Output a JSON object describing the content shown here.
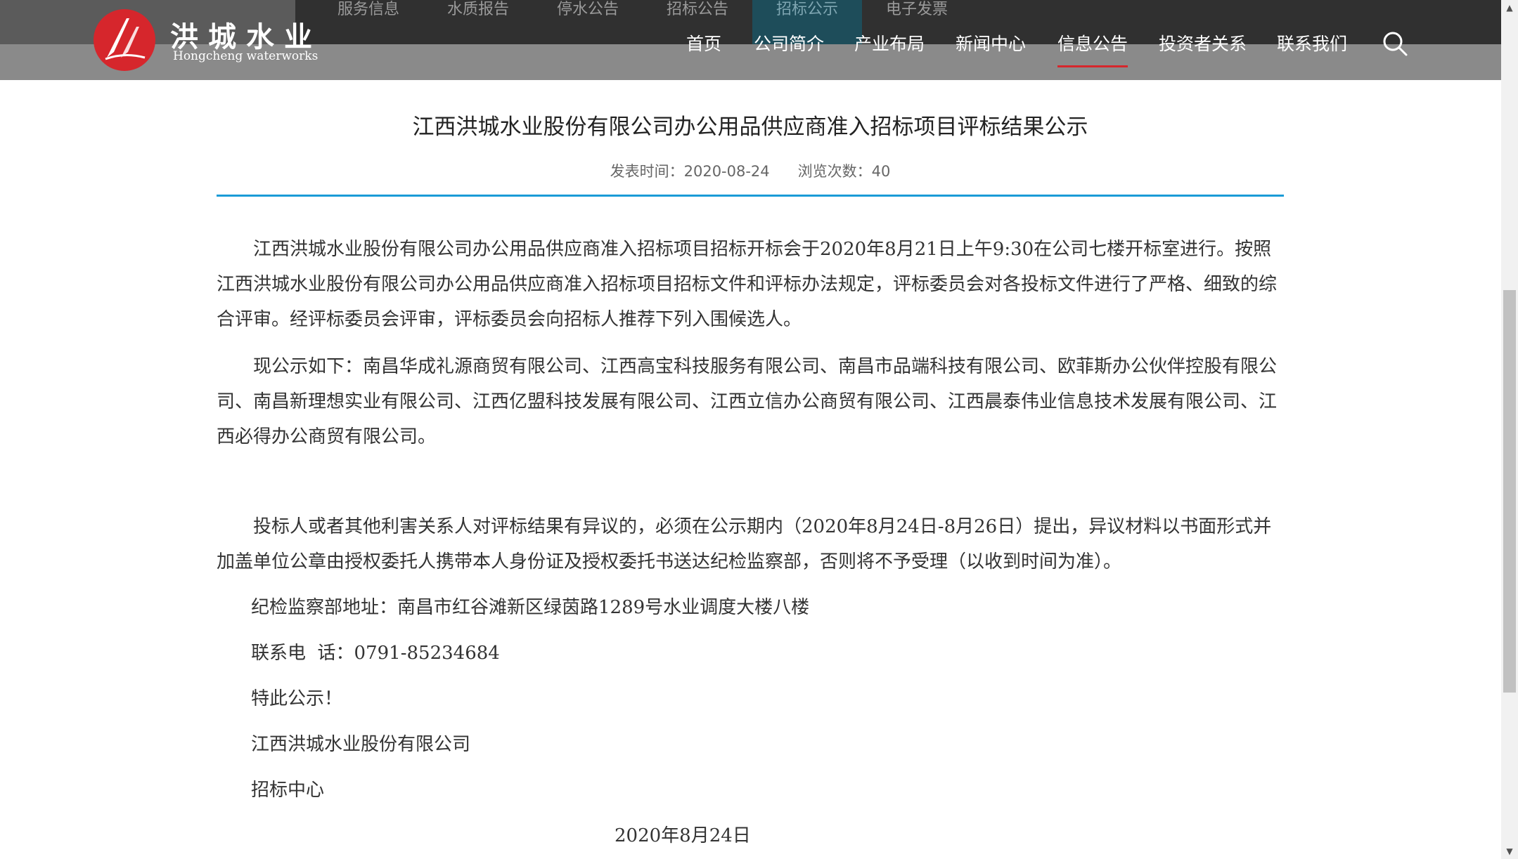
{
  "header": {
    "logo": {
      "name_cn": "洪城水业",
      "name_en": "Hongcheng waterworks",
      "colors": {
        "red": "#d6262c"
      }
    },
    "subnav": [
      {
        "label": "服务信息",
        "active": false
      },
      {
        "label": "水质报告",
        "active": false
      },
      {
        "label": "停水公告",
        "active": false
      },
      {
        "label": "招标公告",
        "active": false
      },
      {
        "label": "招标公示",
        "active": true
      },
      {
        "label": "电子发票",
        "active": false
      }
    ],
    "mainnav": [
      {
        "label": "首页",
        "active": false
      },
      {
        "label": "公司简介",
        "active": false
      },
      {
        "label": "产业布局",
        "active": false
      },
      {
        "label": "新闻中心",
        "active": false
      },
      {
        "label": "信息公告",
        "active": true
      },
      {
        "label": "投资者关系",
        "active": false
      },
      {
        "label": "联系我们",
        "active": false
      }
    ],
    "search_icon": "search-icon"
  },
  "article": {
    "title": "江西洪城水业股份有限公司办公用品供应商准入招标项目评标结果公示",
    "meta": {
      "publish_label": "发表时间：",
      "publish_date": "2020-08-24",
      "views_label": "浏览次数：",
      "views": "40"
    },
    "paragraphs": [
      "江西洪城水业股份有限公司办公用品供应商准入招标项目招标开标会于2020年8月21日上午9:30在公司七楼开标室进行。按照江西洪城水业股份有限公司办公用品供应商准入招标项目招标文件和评标办法规定，评标委员会对各投标文件进行了严格、细致的综合评审。经评标委员会评审，评标委员会向招标人推荐下列入围候选人。",
      "现公示如下：南昌华成礼源商贸有限公司、江西高宝科技服务有限公司、南昌市品端科技有限公司、欧菲斯办公伙伴控股有限公司、南昌新理想实业有限公司、江西亿盟科技发展有限公司、江西立信办公商贸有限公司、江西晨泰伟业信息技术发展有限公司、江西必得办公商贸有限公司。",
      "投标人或者其他利害关系人对评标结果有异议的，必须在公示期内（2020年8月24日-8月26日）提出，异议材料以书面形式并加盖单位公章由授权委托人携带本人身份证及授权委托书送达纪检监察部，否则将不予受理（以收到时间为准）。"
    ],
    "address": "纪检监察部地址：南昌市红谷滩新区绿茵路1289号水业调度大楼八楼",
    "phone": "联系电  话：0791-85234684",
    "closing": "特此公示！",
    "company": "江西洪城水业股份有限公司",
    "department": "招标中心",
    "date": "2020年8月24日"
  },
  "colors": {
    "accent_blue": "#1a9bd7",
    "nav_active_red": "#d6262c",
    "header_bg": "#8a8a8a"
  }
}
